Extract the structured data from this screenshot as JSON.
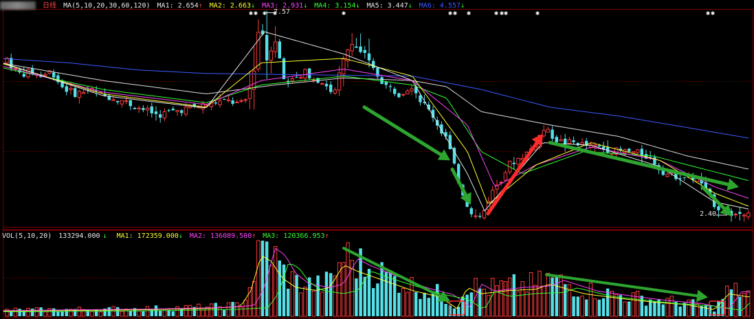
{
  "header": {
    "period": "日线",
    "ma_title": "MA(5,10,20,30,60,120)",
    "ma_items": [
      {
        "label": "MA1:",
        "value": "2.654",
        "arrow": "↑",
        "color": "#e8e8e8"
      },
      {
        "label": "MA2:",
        "value": "2.663",
        "arrow": "↓",
        "color": "#ffff33"
      },
      {
        "label": "MA3:",
        "value": "2.931",
        "arrow": "↓",
        "color": "#ff44ff"
      },
      {
        "label": "MA4:",
        "value": "3.154",
        "arrow": "↓",
        "color": "#33ff33"
      },
      {
        "label": "MA5:",
        "value": "3.447",
        "arrow": "↓",
        "color": "#e8e8e8"
      },
      {
        "label": "MA6:",
        "value": "4.557",
        "arrow": "↓",
        "color": "#3b5bff"
      }
    ]
  },
  "volume_header": {
    "title": "VOL(5,10,20)",
    "current": "133294.000",
    "current_arrow": "↓",
    "items": [
      {
        "label": "MA1:",
        "value": "172359.000",
        "arrow": "↓",
        "color": "#ffff33"
      },
      {
        "label": "MA2:",
        "value": "136089.500",
        "arrow": "↑",
        "color": "#ff44ff"
      },
      {
        "label": "MA3:",
        "value": "120366.953",
        "arrow": "↑",
        "color": "#33ff33"
      }
    ]
  },
  "price_labels": {
    "high": "7.57",
    "low": "2.40"
  },
  "colors": {
    "up": "#ff3b3b",
    "down": "#55e0e8",
    "grid": "#7a0000",
    "ma5": "#e8e8e8",
    "ma10": "#ffff33",
    "ma20": "#ff44ff",
    "ma30": "#33ff33",
    "ma60": "#dddddd",
    "ma120": "#3b5bff",
    "annotation_arrow": "#2ea52e",
    "annotation_up_arrow": "#ff2a2a"
  },
  "chart_data": {
    "type": "candlestick",
    "panes": [
      "price",
      "volume"
    ],
    "price_path": [
      [
        0,
        3.45
      ],
      [
        10,
        3.5
      ],
      [
        20,
        3.38
      ],
      [
        30,
        3.32
      ],
      [
        45,
        3.35
      ],
      [
        60,
        3.3
      ],
      [
        75,
        3.36
      ],
      [
        90,
        3.18
      ],
      [
        110,
        3.1
      ],
      [
        130,
        3.15
      ],
      [
        150,
        3.08
      ],
      [
        170,
        3.05
      ],
      [
        190,
        2.98
      ],
      [
        210,
        2.92
      ],
      [
        230,
        2.86
      ],
      [
        250,
        2.9
      ],
      [
        270,
        2.93
      ],
      [
        290,
        2.96
      ],
      [
        310,
        3.0
      ],
      [
        330,
        3.02
      ],
      [
        350,
        2.98
      ],
      [
        360,
        3.05
      ],
      [
        370,
        3.4
      ],
      [
        378,
        3.95
      ],
      [
        384,
        3.7
      ],
      [
        390,
        3.4
      ],
      [
        398,
        3.8
      ],
      [
        405,
        3.55
      ],
      [
        415,
        3.2
      ],
      [
        425,
        3.3
      ],
      [
        435,
        3.25
      ],
      [
        445,
        3.35
      ],
      [
        455,
        3.28
      ],
      [
        465,
        3.25
      ],
      [
        475,
        3.2
      ],
      [
        485,
        3.05
      ],
      [
        495,
        3.35
      ],
      [
        503,
        3.55
      ],
      [
        512,
        3.7
      ],
      [
        520,
        3.6
      ],
      [
        530,
        3.55
      ],
      [
        540,
        3.4
      ],
      [
        550,
        3.3
      ],
      [
        560,
        3.2
      ],
      [
        570,
        3.15
      ],
      [
        580,
        3.1
      ],
      [
        590,
        3.15
      ],
      [
        600,
        3.2
      ],
      [
        610,
        3.05
      ],
      [
        620,
        2.95
      ],
      [
        630,
        2.85
      ],
      [
        640,
        2.7
      ],
      [
        650,
        2.6
      ],
      [
        660,
        2.3
      ],
      [
        670,
        2.05
      ],
      [
        680,
        1.85
      ],
      [
        690,
        1.72
      ],
      [
        700,
        1.7
      ],
      [
        710,
        1.9
      ],
      [
        720,
        2.05
      ],
      [
        730,
        2.15
      ],
      [
        740,
        2.3
      ],
      [
        750,
        2.35
      ],
      [
        760,
        2.4
      ],
      [
        770,
        2.45
      ],
      [
        780,
        2.55
      ],
      [
        790,
        2.7
      ],
      [
        800,
        2.65
      ],
      [
        810,
        2.58
      ],
      [
        820,
        2.55
      ],
      [
        830,
        2.55
      ],
      [
        840,
        2.55
      ],
      [
        850,
        2.52
      ],
      [
        860,
        2.5
      ],
      [
        870,
        2.5
      ],
      [
        880,
        2.48
      ],
      [
        890,
        2.47
      ],
      [
        900,
        2.45
      ],
      [
        910,
        2.45
      ],
      [
        920,
        2.44
      ],
      [
        930,
        2.43
      ],
      [
        940,
        2.4
      ],
      [
        950,
        2.35
      ],
      [
        960,
        2.25
      ],
      [
        970,
        2.2
      ],
      [
        980,
        2.18
      ],
      [
        990,
        2.17
      ],
      [
        1000,
        2.15
      ],
      [
        1010,
        2.15
      ],
      [
        1020,
        2.1
      ],
      [
        1030,
        1.95
      ],
      [
        1040,
        1.85
      ],
      [
        1050,
        1.78
      ],
      [
        1060,
        1.75
      ],
      [
        1070,
        1.74
      ],
      [
        1080,
        1.76
      ],
      [
        1090,
        1.8
      ]
    ],
    "ma_lines": {
      "ma120": [
        [
          0,
          3.5
        ],
        [
          100,
          3.45
        ],
        [
          200,
          3.37
        ],
        [
          300,
          3.33
        ],
        [
          400,
          3.32
        ],
        [
          500,
          3.31
        ],
        [
          600,
          3.3
        ],
        [
          700,
          3.15
        ],
        [
          800,
          2.95
        ],
        [
          900,
          2.85
        ],
        [
          1000,
          2.72
        ],
        [
          1090,
          2.6
        ]
      ],
      "ma60": [
        [
          0,
          3.45
        ],
        [
          150,
          3.25
        ],
        [
          300,
          3.1
        ],
        [
          400,
          3.2
        ],
        [
          500,
          3.28
        ],
        [
          600,
          3.25
        ],
        [
          650,
          3.18
        ],
        [
          700,
          2.9
        ],
        [
          800,
          2.75
        ],
        [
          900,
          2.62
        ],
        [
          1000,
          2.4
        ],
        [
          1090,
          2.25
        ]
      ],
      "ma30": [
        [
          0,
          3.4
        ],
        [
          150,
          3.15
        ],
        [
          300,
          3.0
        ],
        [
          380,
          3.2
        ],
        [
          500,
          3.3
        ],
        [
          600,
          3.2
        ],
        [
          650,
          3.05
        ],
        [
          700,
          2.45
        ],
        [
          760,
          2.2
        ],
        [
          850,
          2.45
        ],
        [
          950,
          2.4
        ],
        [
          1090,
          2.12
        ]
      ],
      "ma20": [
        [
          0,
          3.42
        ],
        [
          150,
          3.12
        ],
        [
          300,
          2.98
        ],
        [
          380,
          3.25
        ],
        [
          500,
          3.38
        ],
        [
          600,
          3.25
        ],
        [
          680,
          2.75
        ],
        [
          720,
          2.05
        ],
        [
          780,
          2.3
        ],
        [
          860,
          2.5
        ],
        [
          960,
          2.35
        ],
        [
          1040,
          2.05
        ],
        [
          1090,
          1.92
        ]
      ],
      "ma10": [
        [
          0,
          3.45
        ],
        [
          150,
          3.1
        ],
        [
          300,
          2.95
        ],
        [
          380,
          3.45
        ],
        [
          500,
          3.5
        ],
        [
          600,
          3.3
        ],
        [
          680,
          2.45
        ],
        [
          710,
          1.85
        ],
        [
          780,
          2.3
        ],
        [
          860,
          2.55
        ],
        [
          960,
          2.35
        ],
        [
          1040,
          1.98
        ],
        [
          1090,
          1.83
        ]
      ],
      "ma5": [
        [
          0,
          3.46
        ],
        [
          150,
          3.08
        ],
        [
          300,
          2.94
        ],
        [
          385,
          3.8
        ],
        [
          500,
          3.55
        ],
        [
          600,
          3.25
        ],
        [
          680,
          2.2
        ],
        [
          705,
          1.78
        ],
        [
          790,
          2.55
        ],
        [
          860,
          2.52
        ],
        [
          960,
          2.28
        ],
        [
          1040,
          1.88
        ],
        [
          1090,
          1.8
        ]
      ]
    },
    "volume_profile": [
      [
        0,
        0.08
      ],
      [
        100,
        0.09
      ],
      [
        200,
        0.1
      ],
      [
        300,
        0.12
      ],
      [
        350,
        0.15
      ],
      [
        365,
        0.4
      ],
      [
        380,
        0.95
      ],
      [
        395,
        0.85
      ],
      [
        410,
        0.6
      ],
      [
        430,
        0.45
      ],
      [
        460,
        0.4
      ],
      [
        480,
        0.45
      ],
      [
        500,
        0.8
      ],
      [
        520,
        0.7
      ],
      [
        560,
        0.55
      ],
      [
        600,
        0.4
      ],
      [
        640,
        0.3
      ],
      [
        665,
        0.12
      ],
      [
        680,
        0.45
      ],
      [
        700,
        0.35
      ],
      [
        740,
        0.4
      ],
      [
        780,
        0.42
      ],
      [
        800,
        0.5
      ],
      [
        850,
        0.35
      ],
      [
        900,
        0.28
      ],
      [
        950,
        0.22
      ],
      [
        1000,
        0.18
      ],
      [
        1040,
        0.1
      ],
      [
        1060,
        0.35
      ],
      [
        1090,
        0.3
      ]
    ],
    "annotations": [
      {
        "type": "down-arrow",
        "pane": "price",
        "from": [
          530,
          2.95
        ],
        "to": [
          655,
          2.35
        ]
      },
      {
        "type": "down-arrow",
        "pane": "price",
        "from": [
          658,
          2.25
        ],
        "to": [
          685,
          1.85
        ]
      },
      {
        "type": "up-arrow",
        "pane": "price",
        "from": [
          710,
          1.75
        ],
        "to": [
          790,
          2.65
        ]
      },
      {
        "type": "down-arrow",
        "pane": "price",
        "from": [
          800,
          2.55
        ],
        "to": [
          1075,
          2.05
        ]
      },
      {
        "type": "down-arrow",
        "pane": "price",
        "from": [
          1022,
          2.05
        ],
        "to": [
          1065,
          1.72
        ]
      },
      {
        "type": "down-arrow",
        "pane": "volume",
        "from": [
          500,
          0.9
        ],
        "to": [
          655,
          0.2
        ]
      },
      {
        "type": "down-arrow",
        "pane": "volume",
        "from": [
          795,
          0.55
        ],
        "to": [
          1030,
          0.25
        ]
      },
      {
        "type": "box",
        "pane": "volume",
        "at": 665
      },
      {
        "type": "box",
        "pane": "volume",
        "at": 1043
      }
    ]
  }
}
